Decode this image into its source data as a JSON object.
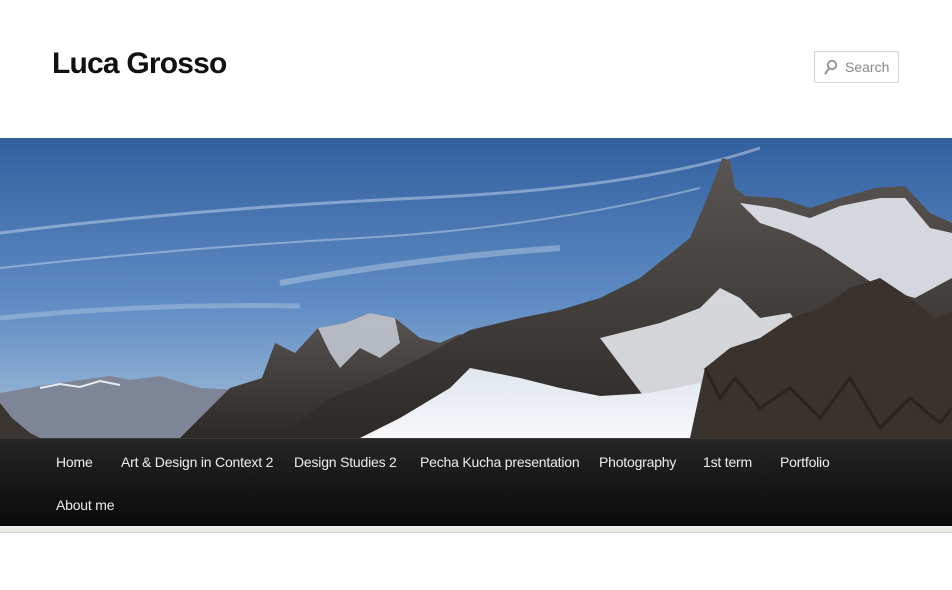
{
  "site": {
    "title": "Luca Grosso"
  },
  "search": {
    "placeholder": "Search",
    "icon": "search-icon"
  },
  "banner": {
    "description_icon": "mountain-banner-image"
  },
  "nav": {
    "items": [
      {
        "label": "Home"
      },
      {
        "label": "Art & Design in Context 2"
      },
      {
        "label": "Design Studies 2"
      },
      {
        "label": "Pecha Kucha presentation"
      },
      {
        "label": "Photography"
      },
      {
        "label": "1st term"
      },
      {
        "label": "Portfolio"
      },
      {
        "label": "About me"
      }
    ]
  },
  "colors": {
    "nav_background": "#111111",
    "nav_text": "#eeeeee",
    "sky": "#4a76b0",
    "title": "#111111"
  }
}
